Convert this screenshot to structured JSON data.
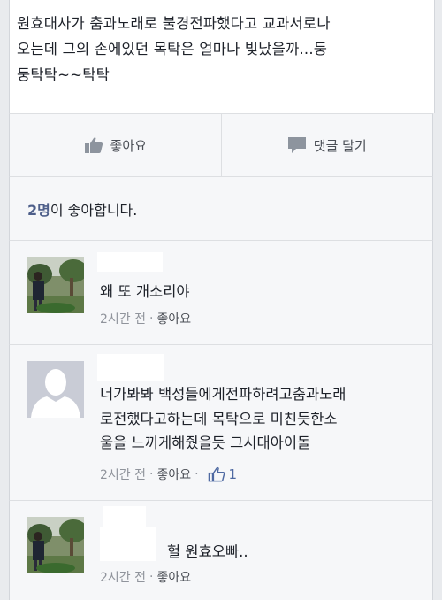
{
  "post": {
    "text": "원효대사가 춤과노래로 불경전파했다고 교과서로나\n오는데 그의 손에있던 목탁은 얼마나 빛났을까...둥\n둥탁탁~~탁탁"
  },
  "actions": {
    "like_label": "좋아요",
    "comment_label": "댓글 달기"
  },
  "likes": {
    "count": "2명",
    "suffix": "이 좋아합니다."
  },
  "comments": [
    {
      "text": "왜 또 개소리야",
      "time": "2시간 전",
      "separator": "·",
      "like_label": "좋아요"
    },
    {
      "text": "너가봐봐 백성들에게전파하려고춤과노래\n로전했다고하는데 목탁으로 미친듯한소\n울을 느끼게해줬을듯 그시대아이돌",
      "time": "2시간 전",
      "separator": "·",
      "like_label": "좋아요",
      "like_count": "1"
    },
    {
      "text": "헐 원효오빠..",
      "time": "2시간 전",
      "separator": "·",
      "like_label": "좋아요"
    }
  ],
  "icons": {
    "like": "thumbs-up-icon",
    "comment": "speech-bubble-icon",
    "avatar_photo": "outdoor-photo-avatar",
    "avatar_default": "default-silhouette-avatar"
  },
  "colors": {
    "like_count_text": "#4e5f8a",
    "meta_text": "#90949c"
  }
}
